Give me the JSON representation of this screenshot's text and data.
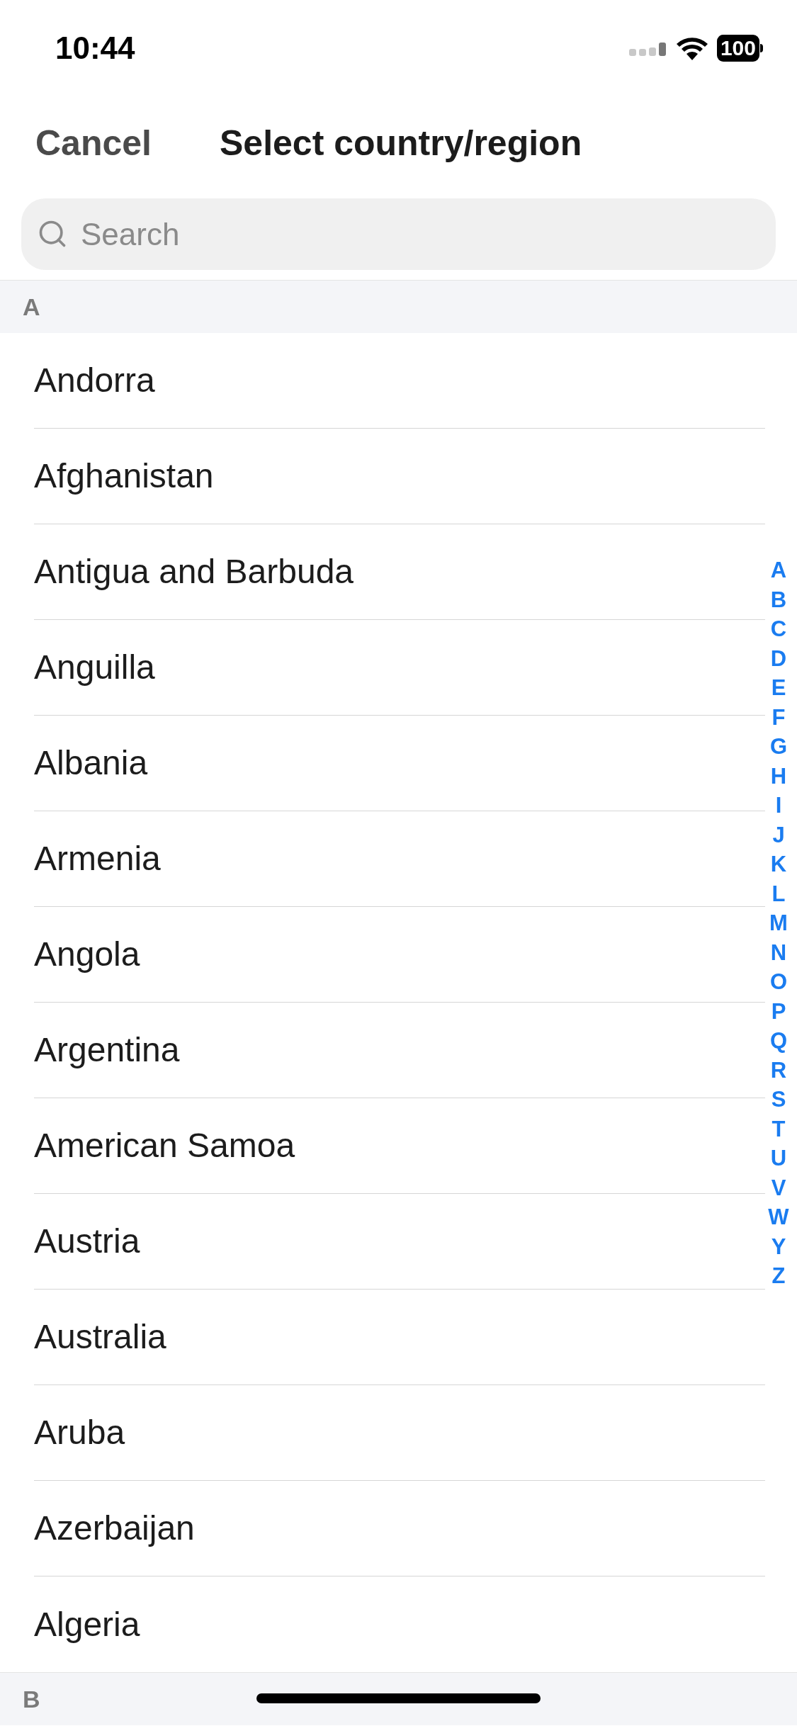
{
  "status_bar": {
    "time": "10:44",
    "battery": "100"
  },
  "header": {
    "cancel": "Cancel",
    "title": "Select country/region"
  },
  "search": {
    "placeholder": "Search"
  },
  "sections": [
    {
      "letter": "A",
      "items": [
        "Andorra",
        "Afghanistan",
        "Antigua and Barbuda",
        "Anguilla",
        "Albania",
        "Armenia",
        "Angola",
        "Argentina",
        "American Samoa",
        "Austria",
        "Australia",
        "Aruba",
        "Azerbaijan",
        "Algeria"
      ]
    },
    {
      "letter": "B"
    }
  ],
  "index": [
    "A",
    "B",
    "C",
    "D",
    "E",
    "F",
    "G",
    "H",
    "I",
    "J",
    "K",
    "L",
    "M",
    "N",
    "O",
    "P",
    "Q",
    "R",
    "S",
    "T",
    "U",
    "V",
    "W",
    "Y",
    "Z"
  ]
}
